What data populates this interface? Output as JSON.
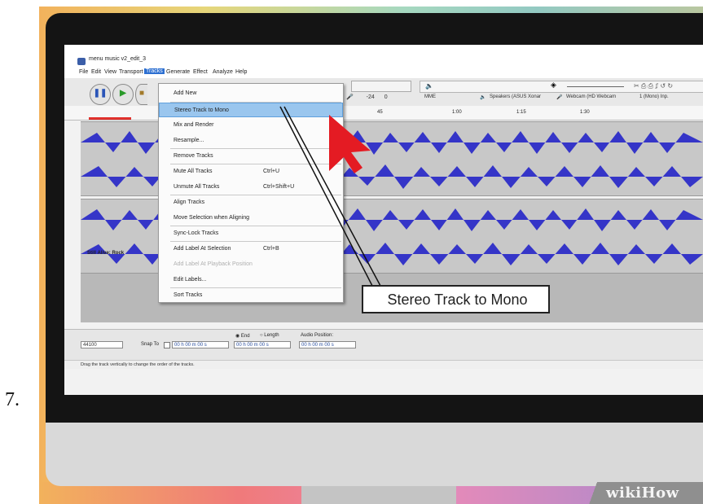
{
  "step": {
    "number": "7."
  },
  "branding": {
    "logo": "wikiHow"
  },
  "app": {
    "title": "menu music v2_edit_3",
    "menubar": [
      "File",
      "Edit",
      "View",
      "Transport",
      "Tracks",
      "Generate",
      "Effect",
      "Analyze",
      "Help"
    ],
    "active_menu": "Tracks",
    "toolbar": {
      "host": "MME",
      "output_device": "Speakers (ASUS Xonar",
      "input_device": "Webcam (HD Webcam",
      "input_channels": "1 (Mono) Inp.",
      "meter_marks": [
        "-24",
        "0"
      ]
    },
    "ruler_labels": [
      "45",
      "1:00",
      "1:15",
      "1:30"
    ],
    "track_name": "Still Alive: Rock",
    "selection_toolbar": {
      "project_rate": "44100",
      "snap_to": "Snap To",
      "end_label": "End",
      "length_label": "Length",
      "audio_position_label": "Audio Position:",
      "time_start": "00 h 00 m 00 s",
      "time_end": "00 h 00 m 00 s",
      "time_position": "00 h 00 m 00 s"
    },
    "status": "Drag the track vertically to change the order of the tracks."
  },
  "tracks_menu": {
    "items": [
      {
        "label": "Add New",
        "shortcut": ""
      },
      {
        "label": "Stereo Track to Mono",
        "shortcut": "",
        "highlighted": true
      },
      {
        "label": "Mix and Render",
        "shortcut": ""
      },
      {
        "label": "Resample...",
        "shortcut": ""
      },
      {
        "label": "Remove Tracks",
        "shortcut": ""
      },
      {
        "label": "Mute All Tracks",
        "shortcut": "Ctrl+U"
      },
      {
        "label": "Unmute All Tracks",
        "shortcut": "Ctrl+Shift+U"
      },
      {
        "label": "Align Tracks",
        "shortcut": ""
      },
      {
        "label": "Move Selection when Aligning",
        "shortcut": ""
      },
      {
        "label": "Sync-Lock Tracks",
        "shortcut": ""
      },
      {
        "label": "Add Label At Selection",
        "shortcut": "Ctrl+B"
      },
      {
        "label": "Add Label At Playback Position",
        "shortcut": "",
        "disabled": true
      },
      {
        "label": "Edit Labels...",
        "shortcut": ""
      },
      {
        "label": "Sort Tracks",
        "shortcut": ""
      }
    ]
  },
  "callout": {
    "text": "Stereo Track to Mono"
  },
  "colors": {
    "waveform": "#3535c8",
    "pointer": "#e41b23",
    "highlight": "#9ac6ee",
    "active_menu": "#2c6fd1"
  }
}
